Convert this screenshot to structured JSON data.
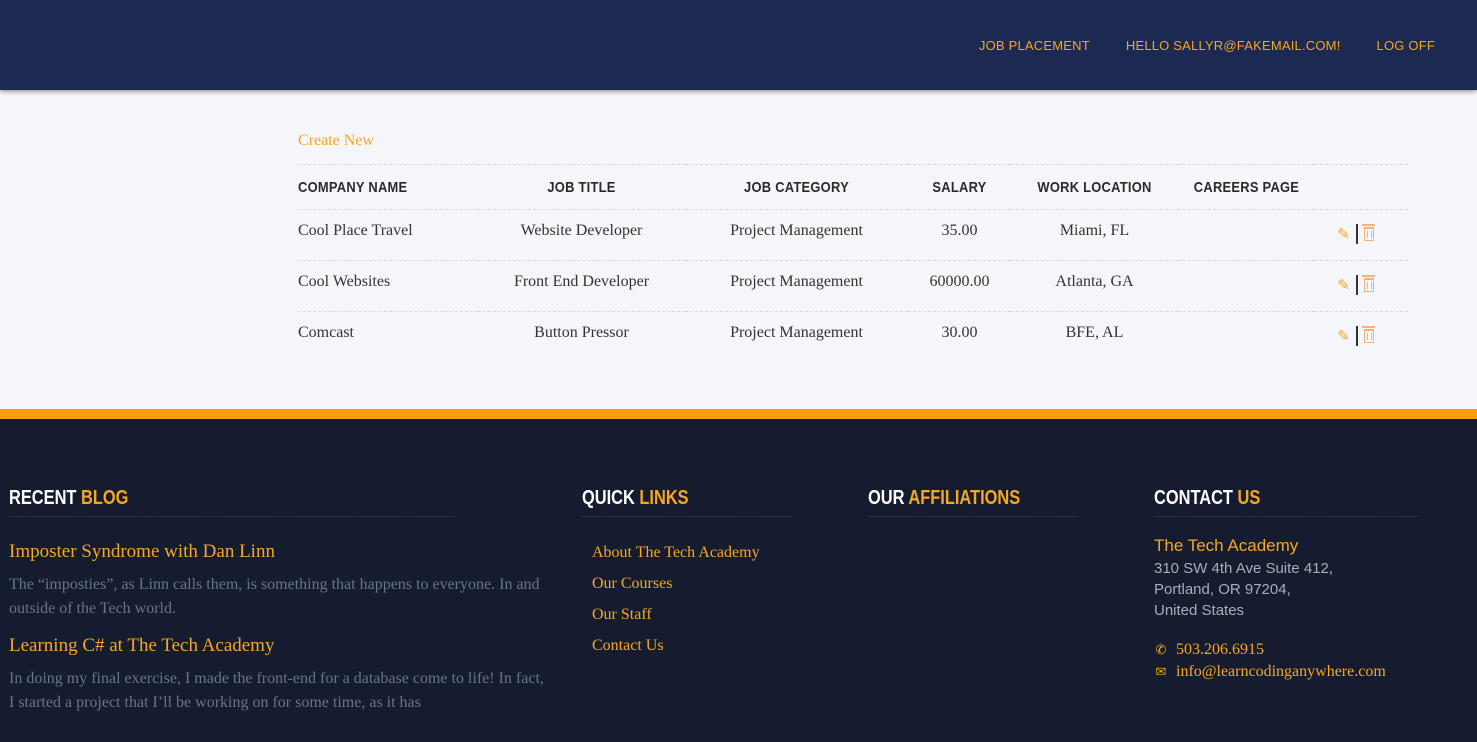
{
  "header": {
    "nav": [
      "JOB PLACEMENT",
      "HELLO SALLYR@FAKEMAIL.COM!",
      "LOG OFF"
    ]
  },
  "main": {
    "create_new": "Create New",
    "columns": [
      "COMPANY NAME",
      "JOB TITLE",
      "JOB CATEGORY",
      "SALARY",
      "WORK LOCATION",
      "CAREERS PAGE"
    ],
    "rows": [
      {
        "company": "Cool Place Travel",
        "title": "Website Developer",
        "category": "Project Management",
        "salary": "35.00",
        "location": "Miami, FL",
        "careers": ""
      },
      {
        "company": "Cool Websites",
        "title": "Front End Developer",
        "category": "Project Management",
        "salary": "60000.00",
        "location": "Atlanta, GA",
        "careers": ""
      },
      {
        "company": "Comcast",
        "title": "Button Pressor",
        "category": "Project Management",
        "salary": "30.00",
        "location": "BFE, AL",
        "careers": ""
      }
    ],
    "icons": {
      "edit": "pencil-icon",
      "delete": "trash-icon"
    }
  },
  "footer": {
    "blog": {
      "heading_plain": "RECENT",
      "heading_accent": "BLOG",
      "posts": [
        {
          "title": "Imposter Syndrome with Dan Linn",
          "excerpt": "The “imposties”, as Linn calls them, is something that happens to everyone. In and outside of the Tech world."
        },
        {
          "title": "Learning C# at The Tech Academy",
          "excerpt": "In doing my final exercise, I made the front-end for a database come to life! In fact, I started a project that I’ll be working on for some time, as it has"
        }
      ]
    },
    "quick_links": {
      "heading_plain": "QUICK",
      "heading_accent": "LINKS",
      "items": [
        "About The Tech Academy",
        "Our Courses",
        "Our Staff",
        "Contact Us"
      ]
    },
    "affiliations": {
      "heading_plain": "OUR",
      "heading_accent": "AFFILIATIONS"
    },
    "contact": {
      "heading_plain": "CONTACT",
      "heading_accent": "US",
      "org": "The Tech Academy",
      "address_lines": [
        "310 SW 4th Ave Suite 412,",
        "Portland, OR 97204,",
        "United States"
      ],
      "phone": "503.206.6915",
      "email": "info@learncodinganywhere.com"
    }
  },
  "colors": {
    "navy": "#1c2951",
    "accent": "#f5a623",
    "footer_bg": "#161c2f"
  }
}
